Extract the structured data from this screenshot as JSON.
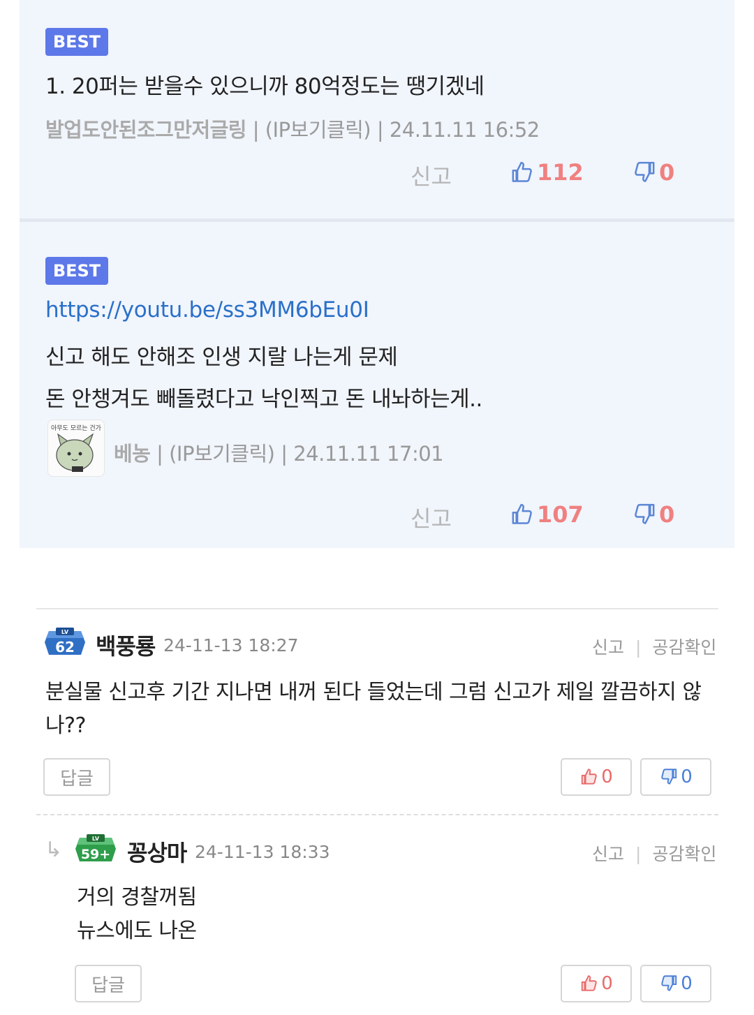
{
  "best_comments": [
    {
      "badge": "BEST",
      "lines": [
        "1. 20퍼는 받을수 있으니까 80억정도는 땡기겠네"
      ],
      "link": "",
      "nickname": "발업도안된조그만저글링",
      "ip_label": "(IP보기클릭)",
      "datetime": "24.11.11 16:52",
      "report_label": "신고",
      "likes": "112",
      "dislikes": "0"
    },
    {
      "badge": "BEST",
      "link": "https://youtu.be/ss3MM6bEu0I",
      "lines": [
        "신고 해도 안해조 인생 지랄 나는게 문제",
        "돈 안챙겨도 빼돌렸다고 낙인찍고 돈 내놔하는게.."
      ],
      "avatar_caption": "아무도 모르는 건가",
      "nickname": "베농",
      "ip_label": "(IP보기클릭)",
      "datetime": "24.11.11 17:01",
      "report_label": "신고",
      "likes": "107",
      "dislikes": "0"
    }
  ],
  "comments": [
    {
      "level_badge": "62",
      "level_prefix": "LV",
      "nickname": "백풍룡",
      "datetime": "24-11-13 18:27",
      "report_label": "신고",
      "separator": "|",
      "sympathy_label": "공감확인",
      "body_lines": [
        "분실물 신고후 기간 지나면 내꺼 된다 들었는데 그럼 신고가 제일 깔끔하지 않",
        "나??"
      ],
      "reply_label": "답글",
      "likes": "0",
      "dislikes": "0"
    },
    {
      "reply_arrow": "↳",
      "level_badge": "59+",
      "level_prefix": "LV",
      "nickname": "꽁상마",
      "datetime": "24-11-13 18:33",
      "report_label": "신고",
      "separator": "|",
      "sympathy_label": "공감확인",
      "body_lines": [
        "거의 경찰꺼됨",
        "뉴스에도 나온"
      ],
      "reply_label": "답글",
      "likes": "0",
      "dislikes": "0"
    }
  ],
  "colors": {
    "best_badge": "#5d78e8",
    "best_bg": "#f1f5fc",
    "link": "#2a70c9",
    "like": "#f08080",
    "thumb_up_icon": "#5b86d6",
    "vote_down_blue": "#4b7fd6",
    "level_blue": "#2f6fc4",
    "level_green": "#2e9e4b"
  },
  "icons": [
    "thumbs-up-icon",
    "thumbs-down-icon",
    "reply-arrow-icon",
    "level-badge-icon"
  ]
}
